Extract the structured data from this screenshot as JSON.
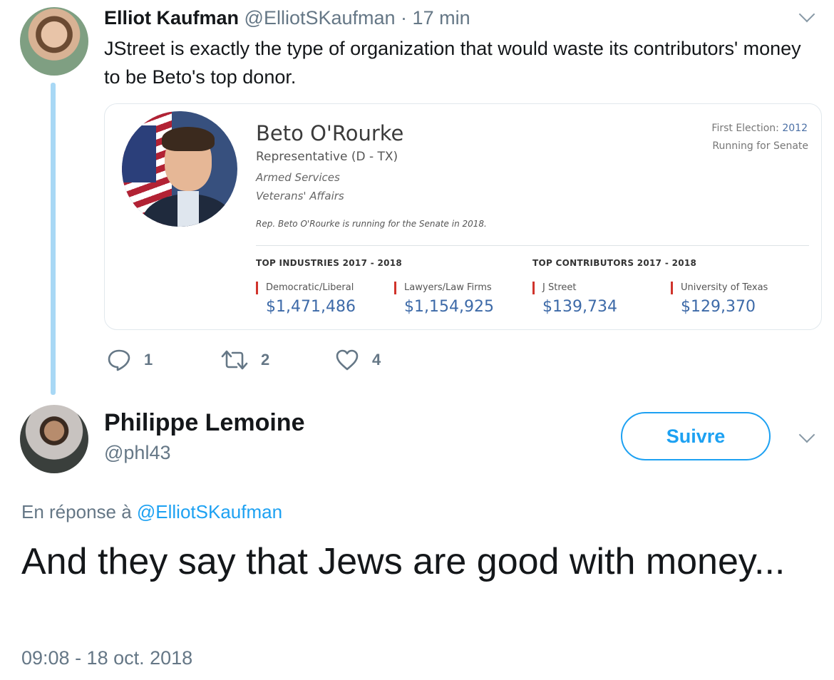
{
  "tweet1": {
    "name": "Elliot Kaufman",
    "handle": "@ElliotSKaufman",
    "separator": " · ",
    "time": "17 min",
    "text": "JStreet is exactly the type of organization that would waste its contributors' money to be Beto's top donor.",
    "card": {
      "name": "Beto O'Rourke",
      "title": "Representative (D - TX)",
      "committees": [
        "Armed Services",
        "Veterans' Affairs"
      ],
      "note": "Rep. Beto O'Rourke is running for the Senate in 2018.",
      "first_election_label": "First Election: ",
      "first_election_year": "2012",
      "running": "Running for Senate",
      "industries_heading": "TOP INDUSTRIES 2017 - 2018",
      "contributors_heading": "TOP CONTRIBUTORS 2017 - 2018",
      "industries": [
        {
          "label": "Democratic/Liberal",
          "value": "$1,471,486"
        },
        {
          "label": "Lawyers/Law Firms",
          "value": "$1,154,925"
        }
      ],
      "contributors": [
        {
          "label": "J Street",
          "value": "$139,734"
        },
        {
          "label": "University of Texas",
          "value": "$129,370"
        }
      ],
      "accent_color": "#d0342c",
      "value_color": "#3d6aa8"
    },
    "actions": {
      "replies": "1",
      "retweets": "2",
      "likes": "4"
    }
  },
  "tweet2": {
    "name": "Philippe Lemoine",
    "handle": "@phl43",
    "follow_label": "Suivre",
    "reply_prefix": "En réponse à ",
    "reply_mention": "@ElliotSKaufman",
    "text": "And they say that Jews are good with money...",
    "timestamp": "09:08 - 18 oct. 2018"
  },
  "colors": {
    "brand": "#1da1f2",
    "thread_line": "#a8d8f5",
    "muted": "#657786"
  }
}
